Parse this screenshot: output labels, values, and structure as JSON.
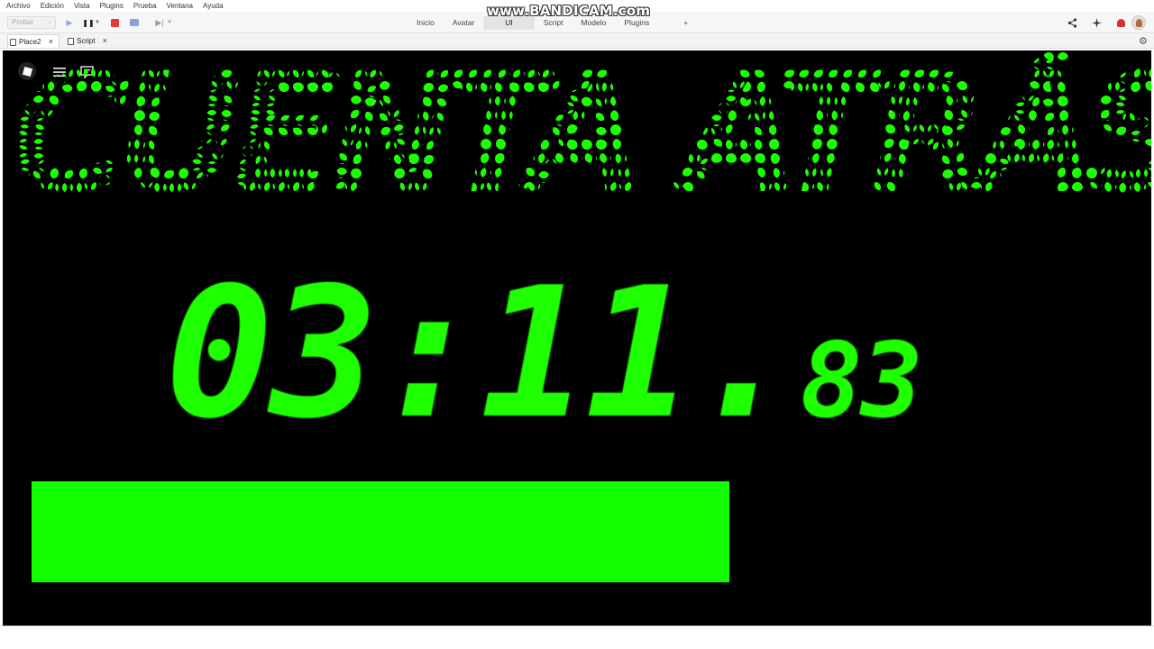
{
  "menu": {
    "items": [
      "Archivo",
      "Edición",
      "Vista",
      "Plugins",
      "Prueba",
      "Ventana",
      "Ayuda"
    ]
  },
  "toolbar": {
    "test_dropdown": "Probar",
    "tabs": [
      "Inicio",
      "Avatar",
      "UI",
      "Script",
      "Modelo",
      "Plugins"
    ],
    "active_tab": "UI",
    "add_tab": "+"
  },
  "watermark": "www.BANDICAM.com",
  "doc_tabs": [
    {
      "label": "Place2",
      "close": "×"
    },
    {
      "label": "Script",
      "close": "×"
    }
  ],
  "game": {
    "title": "CUENTA ATRÁS",
    "timer_main": "03:11.",
    "timer_ms": "83",
    "progress": 0.64,
    "accent_color": "#1eff00",
    "background_color": "#000000"
  },
  "icons": {
    "play": "play-icon",
    "pause": "pause-icon",
    "stop": "stop-icon",
    "monitor": "monitor-icon",
    "step": "step-forward-icon",
    "share": "share-icon",
    "collab": "sparkle-icon",
    "notifications": "bell-icon",
    "profile": "avatar",
    "settings": "gear-icon",
    "roblox": "roblox-logo-icon",
    "menu": "hamburger-menu-icon",
    "chat": "chat-icon"
  }
}
